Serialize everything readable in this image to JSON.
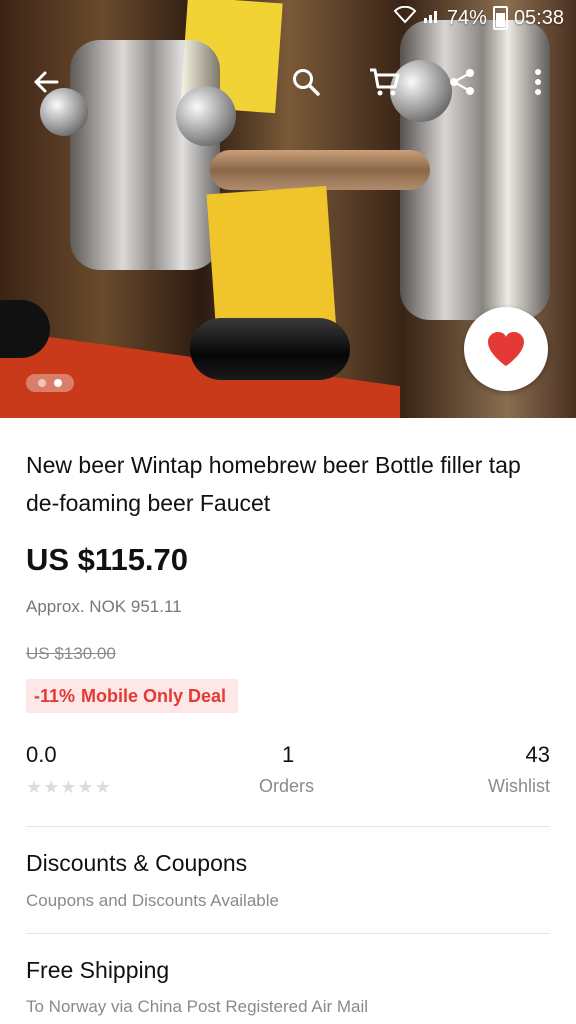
{
  "status_bar": {
    "battery": "74%",
    "time": "05:38"
  },
  "top_bar": {
    "icons": [
      "back-arrow-icon",
      "search-icon",
      "cart-icon",
      "share-icon",
      "more-vert-icon"
    ]
  },
  "gallery": {
    "page_count": 2,
    "active_index": 1,
    "favorite_color": "#e53935"
  },
  "product": {
    "title": "New beer Wintap homebrew beer Bottle filler tap de-foaming beer Faucet",
    "price": "US $115.70",
    "approx": "Approx. NOK 951.11",
    "original_price": "US $130.00",
    "deal": {
      "percent": "-11%",
      "label": "Mobile Only Deal"
    }
  },
  "stats": {
    "rating": "0.0",
    "stars_filled": 0,
    "stars_total": 5,
    "orders_value": "1",
    "orders_label": "Orders",
    "wishlist_value": "43",
    "wishlist_label": "Wishlist"
  },
  "sections": {
    "discounts": {
      "title": "Discounts & Coupons",
      "subtitle": "Coupons and Discounts Available"
    },
    "shipping": {
      "title": "Free Shipping",
      "subtitle": "To Norway via China Post Registered Air Mail"
    }
  }
}
